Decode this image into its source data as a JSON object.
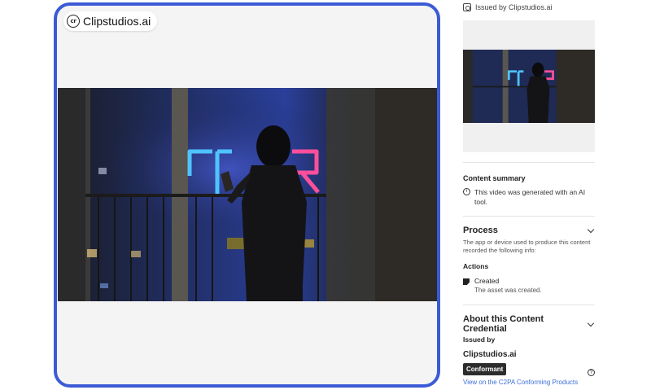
{
  "preview": {
    "issuer_chip_label": "Clipstudios.ai",
    "cr_icon_text": "cr"
  },
  "panel": {
    "issued_by_top": "Issued by Clipstudios.ai",
    "content_summary": {
      "title": "Content summary",
      "text": "This video was generated with an AI tool."
    },
    "process": {
      "title": "Process",
      "description": "The app or device used to produce this content recorded the following info:",
      "actions_label": "Actions",
      "action": {
        "name": "Created",
        "description": "The asset was created."
      }
    },
    "about": {
      "title": "About this Content Credential",
      "issued_by_label": "Issued by",
      "issuer": "Clipstudios.ai",
      "badge": "Conformant",
      "link": "View on the C2PA Conforming Products"
    }
  },
  "colors": {
    "card_border": "#3b5bd6",
    "link": "#3b6fd6",
    "badge_bg": "#2c2c2c"
  }
}
